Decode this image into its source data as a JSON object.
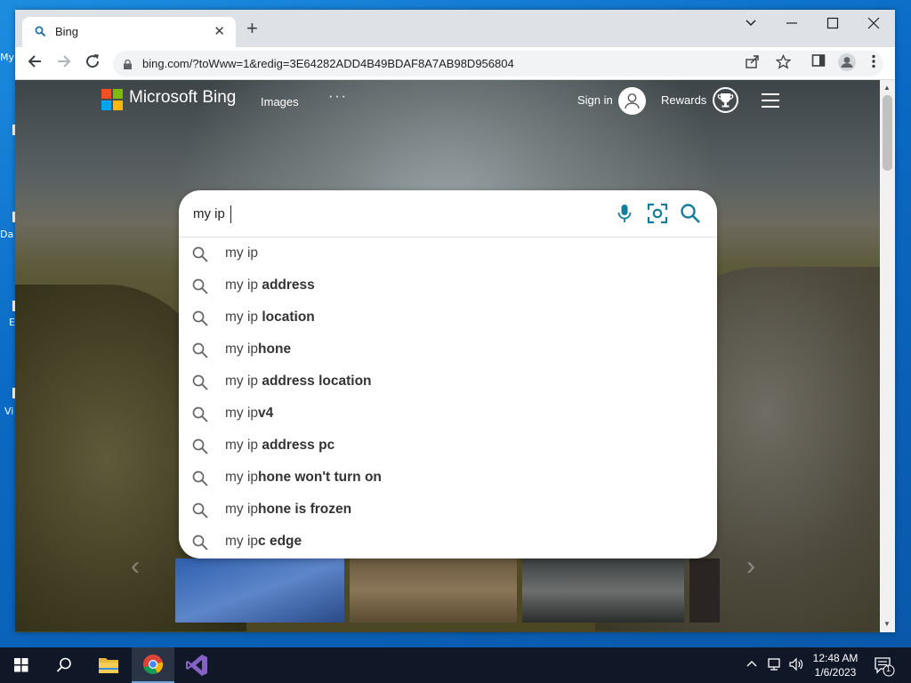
{
  "desktop": {
    "icon_labels": [
      "My",
      "Da",
      "E",
      "Vi"
    ]
  },
  "browser": {
    "tab_title": "Bing",
    "tab_favicon": "search-icon",
    "url": "bing.com/?toWww=1&redig=3E64282ADD4B49BDAF8A7AB98D956804"
  },
  "bing": {
    "brand": "Microsoft Bing",
    "nav_images": "Images",
    "nav_more": "···",
    "sign_in": "Sign in",
    "rewards": "Rewards",
    "colors": {
      "red": "#f25022",
      "green": "#7fba00",
      "blue": "#00a4ef",
      "yellow": "#ffb900",
      "accent": "#137d9b"
    }
  },
  "search": {
    "query": "my ip ",
    "suggestions": [
      {
        "prefix": "my ip",
        "rest": ""
      },
      {
        "prefix": "my ip ",
        "rest": "address"
      },
      {
        "prefix": "my ip ",
        "rest": "location"
      },
      {
        "prefix": "my ip",
        "rest": "hone"
      },
      {
        "prefix": "my ip ",
        "rest": "address location"
      },
      {
        "prefix": "my ip",
        "rest": "v4"
      },
      {
        "prefix": "my ip ",
        "rest": "address pc"
      },
      {
        "prefix": "my ip",
        "rest": "hone won't turn on"
      },
      {
        "prefix": "my ip",
        "rest": "hone is frozen"
      },
      {
        "prefix": "my ip",
        "rest": "c edge"
      }
    ]
  },
  "taskbar": {
    "time": "12:48 AM",
    "date": "1/6/2023",
    "notification_count": "1"
  }
}
